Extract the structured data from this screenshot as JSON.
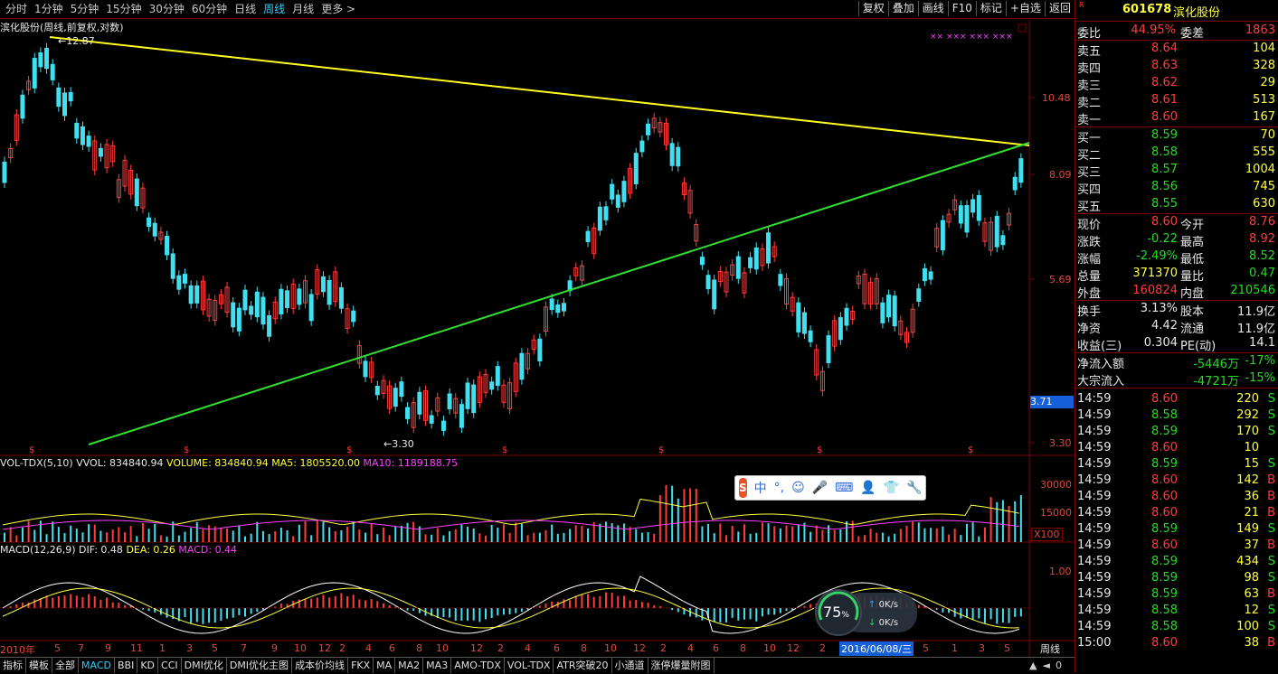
{
  "toolbar": {
    "periods": [
      "分时",
      "1分钟",
      "5分钟",
      "15分钟",
      "30分钟",
      "60分钟",
      "日线",
      "周线",
      "月线",
      "更多 >"
    ],
    "active_period": "周线",
    "right_tools": [
      "复权",
      "叠加",
      "画线",
      "F10",
      "标记",
      "+自选",
      "返回"
    ]
  },
  "chart": {
    "title": "滨化股份(周线,前复权,对数)",
    "high_marker": "12.87",
    "low_marker": "3.30",
    "price_axis": [
      "10.48",
      "8.09",
      "5.69",
      "3.30"
    ],
    "current_price_tag": "3.71",
    "vol_header": {
      "name": "VOL-TDX(5,10)",
      "vvol": "VVOL: 834840.94",
      "volume": "VOLUME: 834840.94",
      "ma5": "MA5: 1805520.00",
      "ma10": "MA10: 1189188.75"
    },
    "vol_axis": [
      "30000",
      "15000",
      "X100"
    ],
    "macd_header": {
      "name": "MACD(12,26,9)",
      "dif": "DIF: 0.48",
      "dea": "DEA: 0.26",
      "macd": "MACD: 0.44"
    },
    "macd_axis": [
      "1.00"
    ],
    "time_axis": [
      "2010年",
      "5",
      "7",
      "9",
      "11",
      "1",
      "3",
      "5",
      "7",
      "9",
      "10",
      "12",
      "2",
      "4",
      "6",
      "8",
      "10",
      "12",
      "2",
      "4",
      "6",
      "8",
      "10",
      "12",
      "2",
      "4",
      "6",
      "8",
      "10",
      "12",
      "2",
      "5",
      "1",
      "3",
      "5",
      "7"
    ],
    "cursor_date": "2016/06/08/三",
    "period_label": "周线"
  },
  "bottom_tabs": [
    "指标",
    "模板",
    "全部",
    "MACD",
    "BBI",
    "KD",
    "CCI",
    "DMI优化",
    "DMI优化主图",
    "成本价均线",
    "FKX",
    "MA",
    "MA2",
    "MA3",
    "AMO-TDX",
    "VOL-TDX",
    "ATR突破20",
    "小通道",
    "涨停爆量附图"
  ],
  "bottom_active": "MACD",
  "speed_widget": {
    "percent": "75",
    "unit": "%",
    "up": "0K/s",
    "down": "0K/s"
  },
  "side": {
    "code": "601678",
    "name": "滨化股份",
    "weibi_label": "委比",
    "weibi": "44.95%",
    "weicha_label": "委差",
    "weicha": "1863",
    "asks": [
      {
        "label": "卖五",
        "price": "8.64",
        "vol": "104"
      },
      {
        "label": "卖四",
        "price": "8.63",
        "vol": "328"
      },
      {
        "label": "卖三",
        "price": "8.62",
        "vol": "29"
      },
      {
        "label": "卖二",
        "price": "8.61",
        "vol": "513"
      },
      {
        "label": "卖一",
        "price": "8.60",
        "vol": "167"
      }
    ],
    "bids": [
      {
        "label": "买一",
        "price": "8.59",
        "vol": "70"
      },
      {
        "label": "买二",
        "price": "8.58",
        "vol": "555"
      },
      {
        "label": "买三",
        "price": "8.57",
        "vol": "1004"
      },
      {
        "label": "买四",
        "price": "8.56",
        "vol": "745"
      },
      {
        "label": "买五",
        "price": "8.55",
        "vol": "630"
      }
    ],
    "quote": [
      {
        "l1": "现价",
        "v1": "8.60",
        "c1": "up",
        "l2": "今开",
        "v2": "8.76",
        "c2": "up"
      },
      {
        "l1": "涨跌",
        "v1": "-0.22",
        "c1": "dn",
        "l2": "最高",
        "v2": "8.92",
        "c2": "up"
      },
      {
        "l1": "涨幅",
        "v1": "-2.49%",
        "c1": "dn",
        "l2": "最低",
        "v2": "8.52",
        "c2": "dn"
      },
      {
        "l1": "总量",
        "v1": "371370",
        "c1": "yl",
        "l2": "量比",
        "v2": "0.47",
        "c2": "dn"
      },
      {
        "l1": "外盘",
        "v1": "160824",
        "c1": "up",
        "l2": "内盘",
        "v2": "210546",
        "c2": "dn"
      }
    ],
    "fund": [
      {
        "l1": "换手",
        "v1": "3.13%",
        "l2": "股本",
        "v2": "11.9亿"
      },
      {
        "l1": "净资",
        "v1": "4.42",
        "l2": "流通",
        "v2": "11.9亿"
      },
      {
        "l1": "收益(三)",
        "v1": "0.304",
        "l2": "PE(动)",
        "v2": "14.1"
      }
    ],
    "flows": [
      {
        "label": "净流入额",
        "amount": "-5446万",
        "pct": "-17%"
      },
      {
        "label": "大宗流入",
        "amount": "-4721万",
        "pct": "-15%"
      }
    ],
    "ticks": [
      {
        "t": "14:59",
        "p": "8.60",
        "v": "220",
        "s": "S"
      },
      {
        "t": "14:59",
        "p": "8.58",
        "v": "292",
        "s": "S"
      },
      {
        "t": "14:59",
        "p": "8.59",
        "v": "170",
        "s": "S"
      },
      {
        "t": "14:59",
        "p": "8.60",
        "v": "10",
        "s": ""
      },
      {
        "t": "14:59",
        "p": "8.59",
        "v": "15",
        "s": "S"
      },
      {
        "t": "14:59",
        "p": "8.60",
        "v": "142",
        "s": "B"
      },
      {
        "t": "14:59",
        "p": "8.60",
        "v": "36",
        "s": "B"
      },
      {
        "t": "14:59",
        "p": "8.60",
        "v": "21",
        "s": "B"
      },
      {
        "t": "14:59",
        "p": "8.59",
        "v": "149",
        "s": "S"
      },
      {
        "t": "14:59",
        "p": "8.60",
        "v": "37",
        "s": "B"
      },
      {
        "t": "14:59",
        "p": "8.59",
        "v": "434",
        "s": "S"
      },
      {
        "t": "14:59",
        "p": "8.59",
        "v": "98",
        "s": "S"
      },
      {
        "t": "14:59",
        "p": "8.59",
        "v": "63",
        "s": "B"
      },
      {
        "t": "14:59",
        "p": "8.58",
        "v": "12",
        "s": "S"
      },
      {
        "t": "14:59",
        "p": "8.58",
        "v": "100",
        "s": "S"
      },
      {
        "t": "15:00",
        "p": "8.60",
        "v": "38",
        "s": "B"
      }
    ]
  }
}
